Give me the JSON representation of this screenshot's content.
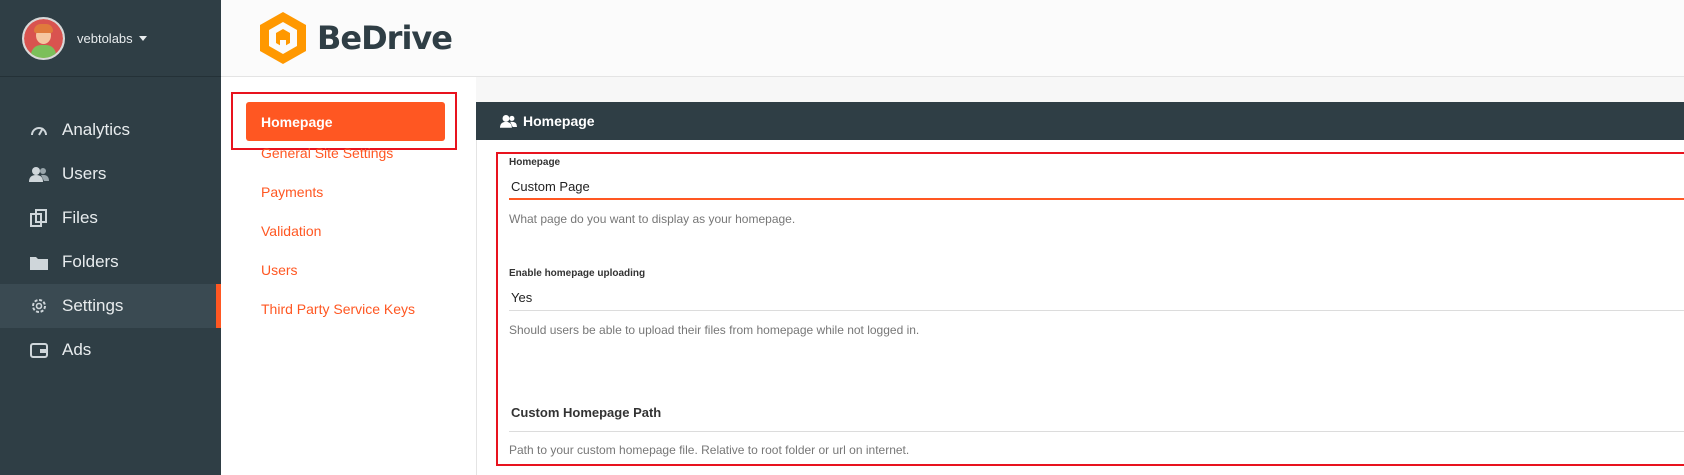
{
  "user": {
    "name": "vebtolabs"
  },
  "sidebar": {
    "items": [
      {
        "label": "Analytics",
        "icon": "gauge-icon"
      },
      {
        "label": "Users",
        "icon": "users-icon"
      },
      {
        "label": "Files",
        "icon": "files-icon"
      },
      {
        "label": "Folders",
        "icon": "folder-icon"
      },
      {
        "label": "Settings",
        "icon": "gear-icon",
        "active": true
      },
      {
        "label": "Ads",
        "icon": "ads-icon"
      }
    ]
  },
  "header": {
    "logo_text": "BeDrive"
  },
  "settings_nav": {
    "active": "Homepage",
    "links": [
      "General Site Settings",
      "Payments",
      "Validation",
      "Users",
      "Third Party Service Keys"
    ]
  },
  "panel": {
    "title": "Homepage",
    "fields": {
      "homepage": {
        "label": "Homepage",
        "value": "Custom Page",
        "help": "What page do you want to display as your homepage."
      },
      "uploading": {
        "label": "Enable homepage uploading",
        "value": "Yes",
        "help": "Should users be able to upload their files from homepage while not logged in."
      },
      "custom_path": {
        "title": "Custom Homepage Path",
        "help": "Path to your custom homepage file. Relative to root folder or url on internet."
      }
    }
  },
  "colors": {
    "accent": "#ff5722",
    "sidebar": "#2f3e45",
    "highlight": "#e8131e"
  }
}
